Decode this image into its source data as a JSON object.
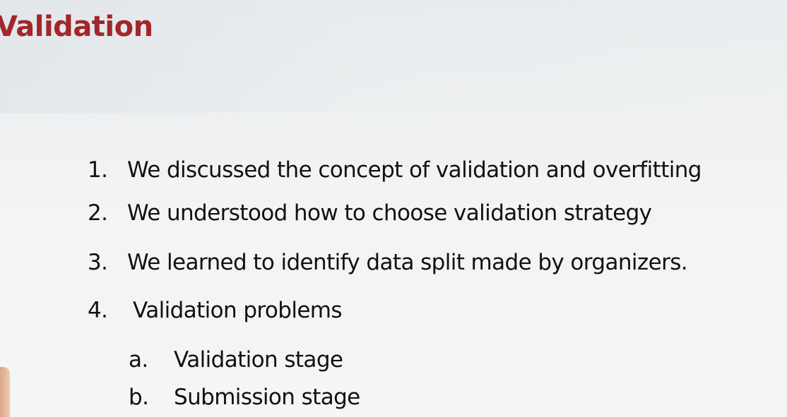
{
  "slide": {
    "title": "Validation",
    "items": [
      {
        "num": "1.",
        "text": "We discussed the concept of validation and overfitting"
      },
      {
        "num": "2.",
        "text": "We understood how to choose validation strategy"
      },
      {
        "num": "3.",
        "text": "We learned to identify data split made by organizers."
      },
      {
        "num": "4.",
        "text": "Validation problems"
      }
    ],
    "subitems": [
      {
        "num": "a.",
        "text": "Validation stage"
      },
      {
        "num": "b.",
        "text": "Submission stage"
      }
    ]
  },
  "colors": {
    "title": "#a3262a",
    "text": "#111111",
    "background": "#f3f4f4"
  }
}
